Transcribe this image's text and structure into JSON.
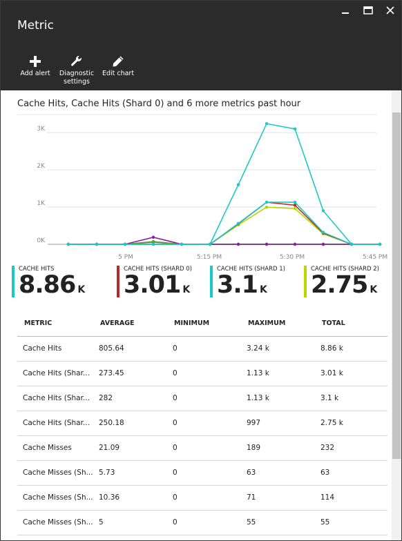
{
  "blade": {
    "title": "Metric"
  },
  "commands": [
    {
      "label": "Add alert",
      "icon": "plus-icon"
    },
    {
      "label": "Diagnostic\nsettings",
      "icon": "wrench-icon"
    },
    {
      "label": "Edit chart",
      "icon": "pencil-icon"
    }
  ],
  "part": {
    "title": "Cache Hits, Cache Hits (Shard 0) and 6 more metrics past hour"
  },
  "chart_data": {
    "type": "line",
    "x": [
      "4:45 PM",
      "4:50 PM",
      "4:55 PM",
      "5 PM",
      "5:05 PM",
      "5:10 PM",
      "5:15 PM",
      "5:20 PM",
      "5:25 PM",
      "5:30 PM",
      "5:35 PM",
      "5:40 PM"
    ],
    "xticks": [
      "5 PM",
      "5:15 PM",
      "5:30 PM",
      "5:45 PM"
    ],
    "yticks": [
      "0K",
      "1K",
      "2K",
      "3K"
    ],
    "ylim": [
      0,
      3300
    ],
    "grid": true,
    "series": [
      {
        "name": "CACHE HITS",
        "color": "#1bc8c8",
        "values": [
          0,
          0,
          0,
          0,
          0,
          0,
          1600,
          3240,
          3100,
          900,
          0,
          0
        ]
      },
      {
        "name": "CACHE HITS (SHARD 0)",
        "color": "#b32a2a",
        "values": [
          0,
          0,
          0,
          0,
          0,
          0,
          550,
          1130,
          1050,
          300,
          0,
          0
        ]
      },
      {
        "name": "CACHE HITS (SHARD 1)",
        "color": "#1bc8c8",
        "values": [
          0,
          0,
          0,
          0,
          0,
          0,
          560,
          1130,
          1130,
          320,
          0,
          0
        ]
      },
      {
        "name": "CACHE HITS (SHARD 2)",
        "color": "#bcd400",
        "values": [
          0,
          0,
          0,
          0,
          0,
          0,
          520,
          997,
          960,
          280,
          0,
          0
        ]
      },
      {
        "name": "CACHE MISSES",
        "color": "#8a1fa0",
        "values": [
          0,
          0,
          0,
          189,
          0,
          0,
          0,
          0,
          0,
          0,
          0,
          0
        ]
      },
      {
        "name": "CACHE MISSES (SHARD 0)",
        "color": "#5aa02c",
        "values": [
          0,
          0,
          0,
          63,
          0,
          0,
          0,
          0,
          0,
          0,
          0,
          0
        ]
      },
      {
        "name": "CACHE MISSES (SHARD 1)",
        "color": "#2e7d4f",
        "values": [
          0,
          0,
          0,
          71,
          0,
          0,
          0,
          0,
          0,
          0,
          0,
          0
        ]
      },
      {
        "name": "CACHE MISSES (SHARD 2)",
        "color": "#6b8e6b",
        "values": [
          0,
          0,
          0,
          55,
          0,
          0,
          0,
          0,
          0,
          0,
          0,
          0
        ]
      }
    ]
  },
  "legend": [
    {
      "name": "CACHE HITS",
      "value": "8.86",
      "unit": "K",
      "color": "#1bc8c8"
    },
    {
      "name": "CACHE HITS (SHARD 0)",
      "value": "3.01",
      "unit": "K",
      "color": "#b32a2a"
    },
    {
      "name": "CACHE HITS (SHARD 1)",
      "value": "3.1",
      "unit": "K",
      "color": "#1bc8c8"
    },
    {
      "name": "CACHE HITS (SHARD 2)",
      "value": "2.75",
      "unit": "K",
      "color": "#bcd400"
    }
  ],
  "grid": {
    "columns": [
      "METRIC",
      "AVERAGE",
      "MINIMUM",
      "MAXIMUM",
      "TOTAL"
    ],
    "rows": [
      [
        "Cache Hits",
        "805.64",
        "0",
        "3.24 k",
        "8.86 k"
      ],
      [
        "Cache Hits (Shar...",
        "273.45",
        "0",
        "1.13 k",
        "3.01 k"
      ],
      [
        "Cache Hits (Shar...",
        "282",
        "0",
        "1.13 k",
        "3.1 k"
      ],
      [
        "Cache Hits (Shar...",
        "250.18",
        "0",
        "997",
        "2.75 k"
      ],
      [
        "Cache Misses",
        "21.09",
        "0",
        "189",
        "232"
      ],
      [
        "Cache Misses (Sh...",
        "5.73",
        "0",
        "63",
        "63"
      ],
      [
        "Cache Misses (Sh...",
        "10.36",
        "0",
        "71",
        "114"
      ],
      [
        "Cache Misses (Sh...",
        "5",
        "0",
        "55",
        "55"
      ]
    ]
  }
}
